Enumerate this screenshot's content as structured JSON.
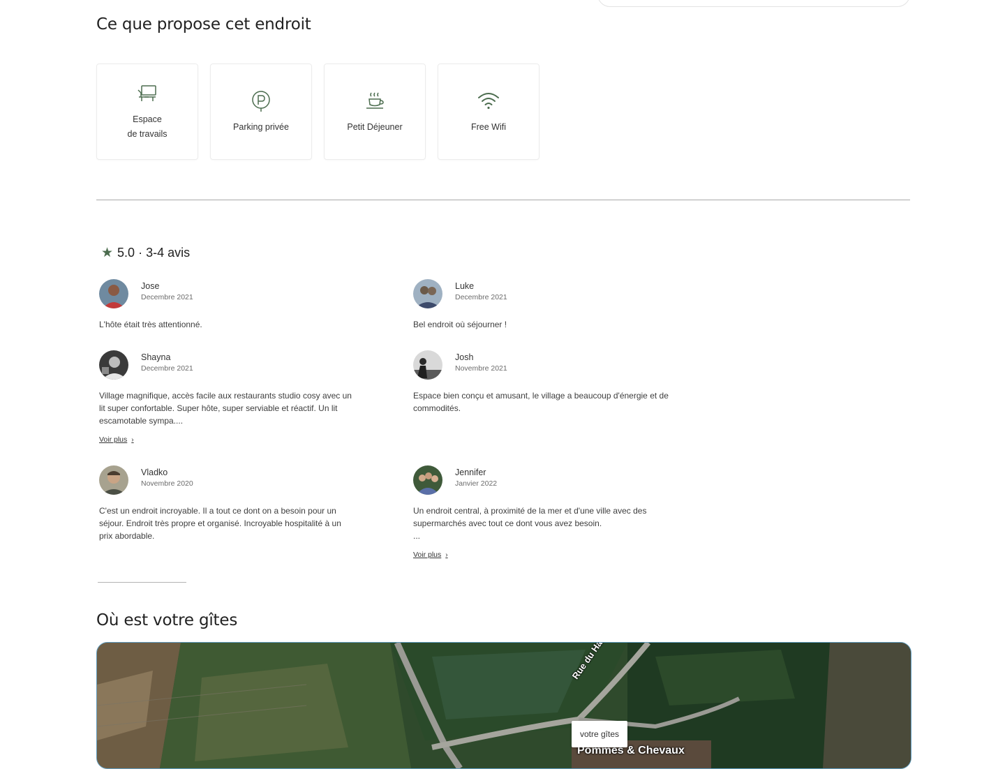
{
  "amenities_section": {
    "title": "Ce que propose cet endroit",
    "items": [
      {
        "icon": "workspace-icon",
        "label": "Espace\nde travails"
      },
      {
        "icon": "parking-icon",
        "label": "Parking privée"
      },
      {
        "icon": "breakfast-icon",
        "label": "Petit Déjeuner"
      },
      {
        "icon": "wifi-icon",
        "label": "Free Wifi"
      }
    ]
  },
  "reviews_section": {
    "rating_text": "5.0 · 3-4 avis",
    "star_color": "#4b6c4e",
    "voir_plus_label": "Voir plus",
    "reviews": [
      {
        "name": "Jose",
        "date": "Decembre 2021",
        "text": "L'hôte était très attentionné."
      },
      {
        "name": "Luke",
        "date": "Decembre 2021",
        "text": "Bel endroit où séjourner !"
      },
      {
        "name": "Shayna",
        "date": "Decembre 2021",
        "text": "Village magnifique, accès facile aux restaurants  studio cosy avec un\nlit super confortable. Super hôte, super serviable et réactif. Un lit\nescamotable sympa...."
      },
      {
        "name": "Josh",
        "date": "Novembre 2021",
        "text": "Espace bien conçu et amusant, le village a beaucoup d'énergie et de\ncommodités."
      },
      {
        "name": "Vladko",
        "date": "Novembre 2020",
        "text": "C'est un endroit incroyable. Il a tout ce dont on a besoin pour un\nséjour. Endroit très propre et organisé. Incroyable hospitalité à un\nprix abordable."
      },
      {
        "name": "Jennifer",
        "date": "Janvier 2022",
        "text": "Un endroit central, à proximité de la mer et d'une ville avec des\nsupermarchés avec tout ce dont vous avez besoin.\n..."
      }
    ]
  },
  "location_section": {
    "title": "Où est votre gîtes",
    "map_marker_label": "votre gîtes",
    "street_label": "Rue du Hamelet",
    "poi_label": "Pommes & Chevaux"
  }
}
